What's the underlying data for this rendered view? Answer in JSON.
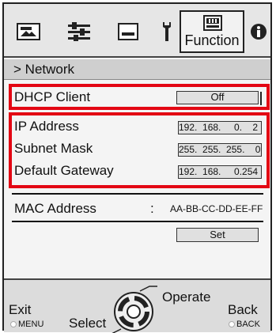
{
  "topbar": {
    "icons": [
      "picture-icon",
      "sliders-icon",
      "display-icon",
      "wrench-icon",
      "function-icon",
      "info-icon"
    ],
    "function_tab_label": "Function"
  },
  "breadcrumb": {
    "prefix": ">",
    "label": "Network"
  },
  "dhcp": {
    "label": "DHCP Client",
    "value": "Off"
  },
  "network": {
    "ip_label": "IP Address",
    "ip_value": "192.  168.     0.    2",
    "subnet_label": "Subnet Mask",
    "subnet_value": "255.  255.  255.    0",
    "gateway_label": "Default Gateway",
    "gateway_value": "192.  168.     0.254"
  },
  "mac": {
    "label": "MAC Address",
    "separator": ":",
    "value": "AA-BB-CC-DD-EE-FF"
  },
  "set_button": "Set",
  "bottom": {
    "exit_label": "Exit",
    "exit_key": "MENU",
    "select_label": "Select",
    "operate_label": "Operate",
    "back_label": "Back",
    "back_key": "BACK"
  },
  "colors": {
    "highlight": "#e30613"
  }
}
